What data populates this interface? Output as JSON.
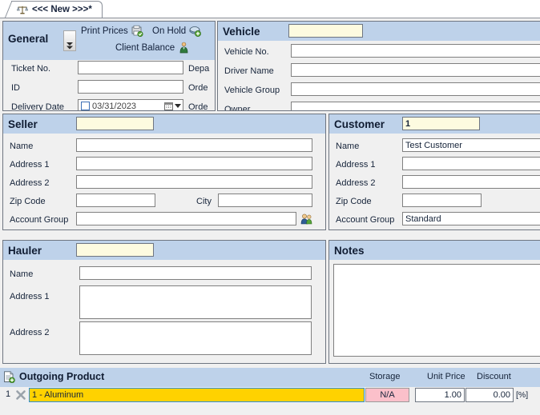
{
  "tab": {
    "label": "<<< New >>>*",
    "icon": "scale-balance-icon"
  },
  "general": {
    "title": "General",
    "print_prices_label": "Print Prices",
    "print_prices_icon": "print-prices-icon",
    "on_hold_label": "On Hold",
    "on_hold_icon": "on-hold-icon",
    "client_balance_label": "Client Balance",
    "client_balance_icon": "client-balance-icon",
    "expander_icon": "expand-down-icon",
    "fields": [
      {
        "label": "Ticket No.",
        "value": ""
      },
      {
        "label": "ID",
        "value": ""
      },
      {
        "label": "Delivery Date",
        "value": "03/31/2023"
      }
    ],
    "right_labels": [
      "Depa",
      "Orde",
      "Orde"
    ],
    "calendar_icon": "calendar-icon",
    "dropdown_icon": "chevron-down-icon"
  },
  "vehicle": {
    "title": "Vehicle",
    "key_value": "",
    "fields": [
      {
        "label": "Vehicle No.",
        "value": ""
      },
      {
        "label": "Driver Name",
        "value": ""
      },
      {
        "label": "Vehicle Group",
        "value": ""
      },
      {
        "label": "Owner",
        "value": ""
      }
    ]
  },
  "seller": {
    "title": "Seller",
    "key_value": "",
    "fields": [
      {
        "label": "Name",
        "value": ""
      },
      {
        "label": "Address 1",
        "value": ""
      },
      {
        "label": "Address 2",
        "value": ""
      },
      {
        "label": "Zip Code",
        "value": ""
      },
      {
        "label": "City",
        "value": ""
      },
      {
        "label": "Account Group",
        "value": ""
      }
    ],
    "account_group_icon": "user-group-add-icon"
  },
  "customer": {
    "title": "Customer",
    "key_value": "1",
    "fields": [
      {
        "label": "Name",
        "value": "Test Customer"
      },
      {
        "label": "Address 1",
        "value": ""
      },
      {
        "label": "Address 2",
        "value": ""
      },
      {
        "label": "Zip Code",
        "value": ""
      },
      {
        "label": "Account Group",
        "value": "Standard"
      }
    ]
  },
  "hauler": {
    "title": "Hauler",
    "key_value": "",
    "fields": [
      {
        "label": "Name",
        "value": ""
      },
      {
        "label": "Address 1",
        "value": ""
      },
      {
        "label": "Address 2",
        "value": ""
      }
    ]
  },
  "notes": {
    "title": "Notes",
    "value": ""
  },
  "outgoing_product": {
    "title": "Outgoing Product",
    "icon": "document-add-icon",
    "columns": {
      "storage": "Storage",
      "unit_price": "Unit Price",
      "discount": "Discount"
    },
    "rows": [
      {
        "number": "1",
        "delete_icon": "delete-x-icon",
        "product": "1 - Aluminum",
        "storage": "N/A",
        "unit_price": "1.00",
        "discount": "0.00",
        "discount_unit": "[%]"
      }
    ]
  },
  "colors": {
    "panel_header": "#bed2ea",
    "key_field": "#fdfbe0",
    "panel_bg": "#f0f0f0",
    "product_row": "#ffd200",
    "storage_cell": "#fbc0ca",
    "border": "#6f7681"
  }
}
